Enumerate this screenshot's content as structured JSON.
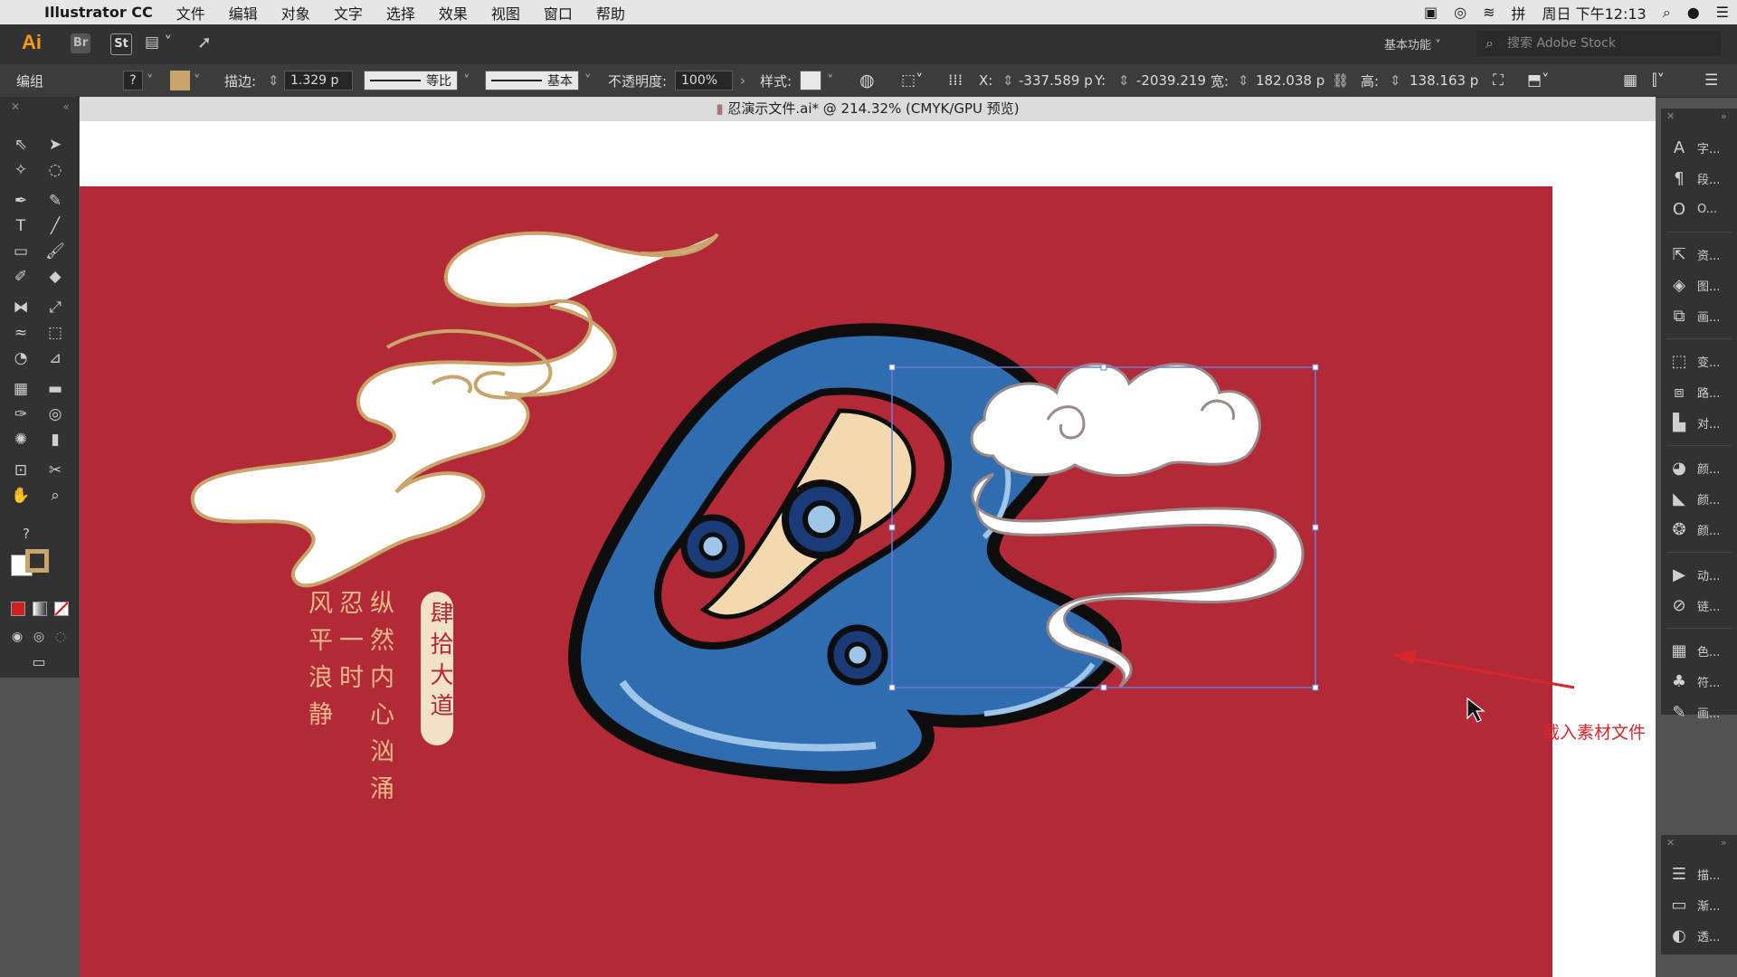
{
  "menubar": {
    "apple": "",
    "app_name": "Illustrator CC",
    "items": [
      "文件",
      "编辑",
      "对象",
      "文字",
      "选择",
      "效果",
      "视图",
      "窗口",
      "帮助"
    ],
    "clock": "周日 下午12:13",
    "input_method": "拼"
  },
  "appbar": {
    "logo": "Ai",
    "br": "Br",
    "st": "St",
    "workspace": "基本功能",
    "search_placeholder": "搜索 Adobe Stock"
  },
  "control_bar": {
    "selection_type": "编组",
    "stroke_label": "描边:",
    "stroke_value": "1.329 p",
    "profile_label": "等比",
    "brush_label": "基本",
    "opacity_label": "不透明度:",
    "opacity_value": "100%",
    "style_label": "样式:",
    "x_label": "X:",
    "x_value": "-337.589 p",
    "y_label": "Y:",
    "y_value": "-2039.219",
    "w_label": "宽:",
    "w_value": "182.038 p",
    "h_label": "高:",
    "h_value": "138.163 p"
  },
  "document": {
    "tab_title": "忍演示文件.ai* @ 214.32% (CMYK/GPU 预览)"
  },
  "artwork": {
    "vertical_texts": [
      "纵然内心汹涌",
      "忍一时",
      "风平浪静"
    ],
    "seal_text": "肆拾大道",
    "annotation": "载入素材文件",
    "colors": {
      "background": "#b32a36",
      "wave_blue": "#2f6db0",
      "wave_dark": "#1a3a78",
      "cloud_fill": "#ffffff",
      "gold": "#c9a46b",
      "cream": "#f3d9b0",
      "selection": "#6e7bd6",
      "annotation": "#d8262b"
    }
  },
  "right_panel": {
    "items": [
      "字...",
      "段...",
      "O...",
      "资...",
      "图...",
      "画...",
      "变...",
      "路...",
      "对...",
      "颜...",
      "颜...",
      "颜...",
      "动...",
      "链...",
      "色...",
      "符...",
      "画..."
    ],
    "bottom_items": [
      "描...",
      "渐...",
      "透..."
    ]
  }
}
